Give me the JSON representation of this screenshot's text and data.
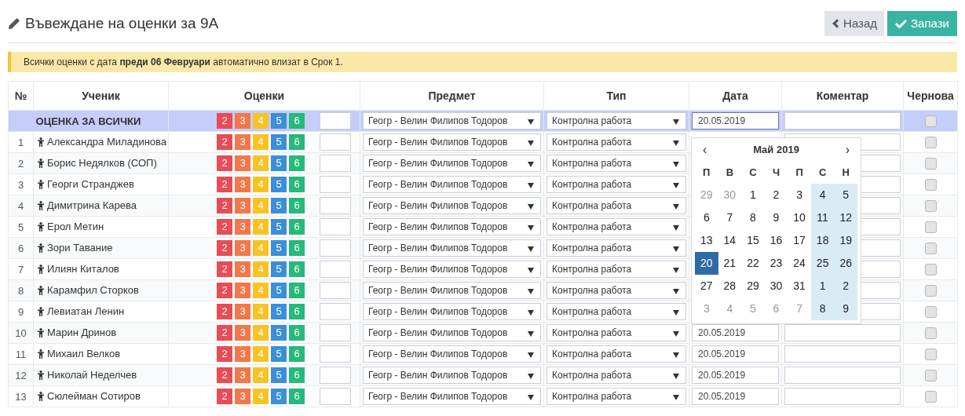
{
  "title": "Въвеждане на оценки за 9А",
  "buttons": [
    {
      "kind": "back",
      "label": "Назад"
    },
    {
      "kind": "save",
      "label": "Запази"
    }
  ],
  "alert": "Всички оценки с дата **преди 06 Февруари** автоматично влизат в Срок 1.",
  "table": {
    "columns": [
      "№",
      "Ученик",
      "Оценки",
      "Предмет",
      "Тип",
      "Дата",
      "Коментар",
      "Чернова"
    ],
    "rows": [
      {
        "kind": "all",
        "name": "ОЦЕНКА ЗА ВСИЧКИ",
        "grades": [
          "2",
          "3",
          "4",
          "5",
          "6"
        ],
        "subject": "Геогр - Велин Филипов Тодоров",
        "type": "Контролна работа",
        "date": "20.05.2019",
        "draft": false
      },
      {
        "kind": "student",
        "no": "1",
        "name": "Александра Миладинова",
        "grades": [
          "2",
          "3",
          "4",
          "5",
          "6"
        ],
        "subject": "Геогр - Велин Филипов Тодоров",
        "type": "Контролна работа",
        "draft": false
      },
      {
        "kind": "student",
        "no": "2",
        "name": "Борис Недялков (СОП)",
        "grades": [
          "2",
          "3",
          "4",
          "5",
          "6"
        ],
        "subject": "Геогр - Велин Филипов Тодоров",
        "type": "Контролна работа",
        "draft": false
      },
      {
        "kind": "student",
        "no": "3",
        "name": "Георги Странджев",
        "grades": [
          "2",
          "3",
          "4",
          "5",
          "6"
        ],
        "subject": "Геогр - Велин Филипов Тодоров",
        "type": "Контролна работа",
        "draft": false
      },
      {
        "kind": "student",
        "no": "4",
        "name": "Димитрина Карева",
        "grades": [
          "2",
          "3",
          "4",
          "5",
          "6"
        ],
        "subject": "Геогр - Велин Филипов Тодоров",
        "type": "Контролна работа",
        "draft": false
      },
      {
        "kind": "student",
        "no": "5",
        "name": "Ерол Метин",
        "grades": [
          "2",
          "3",
          "4",
          "5",
          "6"
        ],
        "subject": "Геогр - Велин Филипов Тодоров",
        "type": "Контролна работа",
        "draft": false
      },
      {
        "kind": "student",
        "no": "6",
        "name": "Зори Тавание",
        "grades": [
          "2",
          "3",
          "4",
          "5",
          "6"
        ],
        "subject": "Геогр - Велин Филипов Тодоров",
        "type": "Контролна работа",
        "draft": false
      },
      {
        "kind": "student",
        "no": "7",
        "name": "Илиян Киталов",
        "grades": [
          "2",
          "3",
          "4",
          "5",
          "6"
        ],
        "subject": "Геогр - Велин Филипов Тодоров",
        "type": "Контролна работа",
        "draft": false
      },
      {
        "kind": "student",
        "no": "8",
        "name": "Карамфил Сторков",
        "grades": [
          "2",
          "3",
          "4",
          "5",
          "6"
        ],
        "subject": "Геогр - Велин Филипов Тодоров",
        "type": "Контролна работа",
        "draft": false
      },
      {
        "kind": "student",
        "no": "9",
        "name": "Левиатан Ленин",
        "grades": [
          "2",
          "3",
          "4",
          "5",
          "6"
        ],
        "subject": "Геогр - Велин Филипов Тодоров",
        "type": "Контролна работа",
        "draft": false
      },
      {
        "kind": "student",
        "no": "10",
        "name": "Марин Дринов",
        "grades": [
          "2",
          "3",
          "4",
          "5",
          "6"
        ],
        "subject": "Геогр - Велин Филипов Тодоров",
        "type": "Контролна работа",
        "date": "20.05.2019",
        "draft": false
      },
      {
        "kind": "student",
        "no": "11",
        "name": "Михаил Велков",
        "grades": [
          "2",
          "3",
          "4",
          "5",
          "6"
        ],
        "subject": "Геогр - Велин Филипов Тодоров",
        "type": "Контролна работа",
        "date": "20.05.2019",
        "draft": false
      },
      {
        "kind": "student",
        "no": "12",
        "name": "Николай Неделчев",
        "grades": [
          "2",
          "3",
          "4",
          "5",
          "6"
        ],
        "subject": "Геогр - Велин Филипов Тодоров",
        "type": "Контролна работа",
        "date": "20.05.2019",
        "draft": false
      },
      {
        "kind": "student",
        "no": "13",
        "name": "Сюлейман Сотиров",
        "grades": [
          "2",
          "3",
          "4",
          "5",
          "6"
        ],
        "subject": "Геогр - Велин Филипов Тодоров",
        "type": "Контролна работа",
        "date": "20.05.2019",
        "draft": false
      }
    ]
  },
  "datepicker": {
    "prev": "‹",
    "month": "Май 2019",
    "next": "›",
    "weekdays": [
      "П",
      "В",
      "С",
      "Ч",
      "П",
      "С",
      "Н"
    ],
    "weeks": [
      [
        {
          "d": "29",
          "muted": true,
          "weekend": false,
          "selected": false
        },
        {
          "d": "30",
          "muted": true,
          "weekend": false,
          "selected": false
        },
        {
          "d": "1",
          "muted": false,
          "weekend": false,
          "selected": false
        },
        {
          "d": "2",
          "muted": false,
          "weekend": false,
          "selected": false
        },
        {
          "d": "3",
          "muted": false,
          "weekend": false,
          "selected": false
        },
        {
          "d": "4",
          "muted": false,
          "weekend": true,
          "selected": false
        },
        {
          "d": "5",
          "muted": false,
          "weekend": true,
          "selected": false
        }
      ],
      [
        {
          "d": "6",
          "muted": false,
          "weekend": false,
          "selected": false
        },
        {
          "d": "7",
          "muted": false,
          "weekend": false,
          "selected": false
        },
        {
          "d": "8",
          "muted": false,
          "weekend": false,
          "selected": false
        },
        {
          "d": "9",
          "muted": false,
          "weekend": false,
          "selected": false
        },
        {
          "d": "10",
          "muted": false,
          "weekend": false,
          "selected": false
        },
        {
          "d": "11",
          "muted": false,
          "weekend": true,
          "selected": false
        },
        {
          "d": "12",
          "muted": false,
          "weekend": true,
          "selected": false
        }
      ],
      [
        {
          "d": "13",
          "muted": false,
          "weekend": false,
          "selected": false
        },
        {
          "d": "14",
          "muted": false,
          "weekend": false,
          "selected": false
        },
        {
          "d": "15",
          "muted": false,
          "weekend": false,
          "selected": false
        },
        {
          "d": "16",
          "muted": false,
          "weekend": false,
          "selected": false
        },
        {
          "d": "17",
          "muted": false,
          "weekend": false,
          "selected": false
        },
        {
          "d": "18",
          "muted": false,
          "weekend": true,
          "selected": false
        },
        {
          "d": "19",
          "muted": false,
          "weekend": true,
          "selected": false
        }
      ],
      [
        {
          "d": "20",
          "muted": false,
          "weekend": false,
          "selected": true
        },
        {
          "d": "21",
          "muted": false,
          "weekend": false,
          "selected": false
        },
        {
          "d": "22",
          "muted": false,
          "weekend": false,
          "selected": false
        },
        {
          "d": "23",
          "muted": false,
          "weekend": false,
          "selected": false
        },
        {
          "d": "24",
          "muted": false,
          "weekend": false,
          "selected": false
        },
        {
          "d": "25",
          "muted": false,
          "weekend": true,
          "selected": false
        },
        {
          "d": "26",
          "muted": false,
          "weekend": true,
          "selected": false
        }
      ],
      [
        {
          "d": "27",
          "muted": false,
          "weekend": false,
          "selected": false
        },
        {
          "d": "28",
          "muted": false,
          "weekend": false,
          "selected": false
        },
        {
          "d": "29",
          "muted": false,
          "weekend": false,
          "selected": false
        },
        {
          "d": "30",
          "muted": false,
          "weekend": false,
          "selected": false
        },
        {
          "d": "31",
          "muted": false,
          "weekend": false,
          "selected": false
        },
        {
          "d": "1",
          "muted": false,
          "weekend": true,
          "selected": false
        },
        {
          "d": "2",
          "muted": false,
          "weekend": true,
          "selected": false
        }
      ],
      [
        {
          "d": "3",
          "muted": true,
          "weekend": false,
          "selected": false
        },
        {
          "d": "4",
          "muted": true,
          "weekend": false,
          "selected": false
        },
        {
          "d": "5",
          "muted": true,
          "weekend": false,
          "selected": false
        },
        {
          "d": "6",
          "muted": true,
          "weekend": false,
          "selected": false
        },
        {
          "d": "7",
          "muted": true,
          "weekend": false,
          "selected": false
        },
        {
          "d": "8",
          "muted": false,
          "weekend": true,
          "selected": false
        },
        {
          "d": "9",
          "muted": false,
          "weekend": true,
          "selected": false
        }
      ]
    ]
  }
}
